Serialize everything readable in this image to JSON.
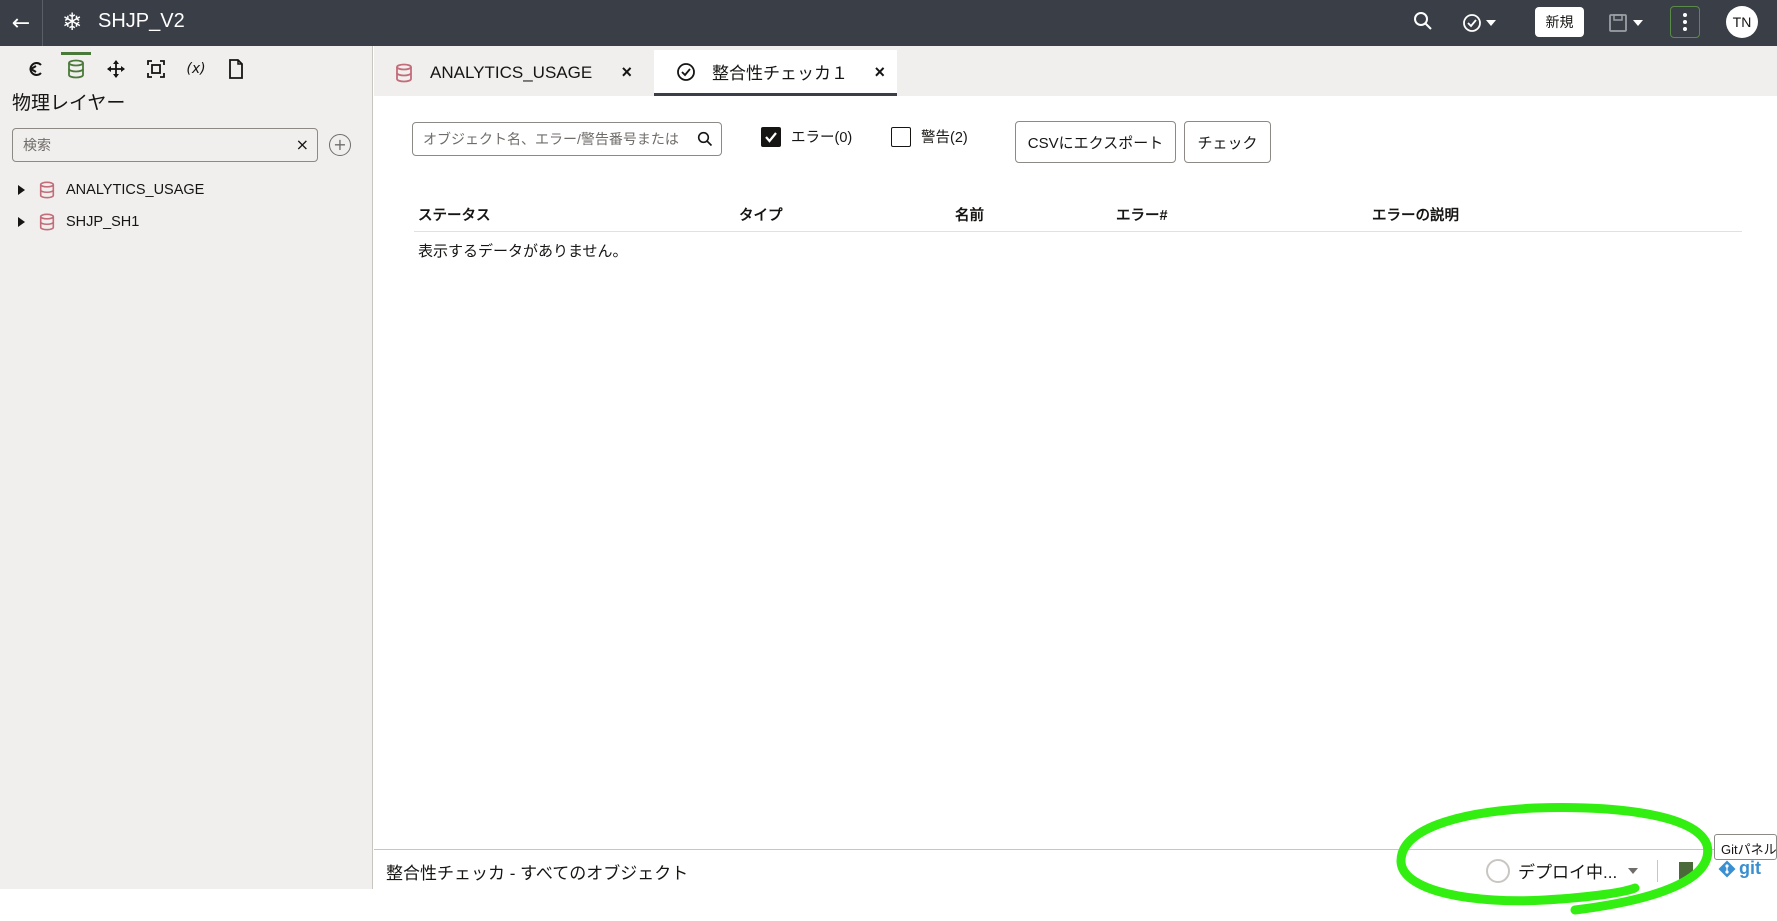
{
  "header": {
    "back_label": "←",
    "app_title": "SHJP_V2",
    "new_button": "新規",
    "avatar_initials": "TN"
  },
  "left_panel": {
    "title": "物理レイヤー",
    "search_placeholder": "検索",
    "search_clear": "×",
    "add_label": "+",
    "tools": [
      "refresh-icon",
      "database-icon",
      "move-icon",
      "frame-icon",
      "variable-icon",
      "document-icon"
    ],
    "tools_variable_label": "(x)",
    "tree": [
      {
        "label": "ANALYTICS_USAGE"
      },
      {
        "label": "SHJP_SH1"
      }
    ]
  },
  "tabs": [
    {
      "label": "ANALYTICS_USAGE",
      "icon": "database-icon",
      "close": "×",
      "active": false
    },
    {
      "label": "整合性チェッカ１",
      "icon": "check-circle-icon",
      "close": "×",
      "active": true
    }
  ],
  "main": {
    "filter_placeholder": "オブジェクト名、エラー/警告番号または",
    "errors_checkbox": {
      "label": "エラー(0)",
      "checked": true
    },
    "warnings_checkbox": {
      "label": "警告(2)",
      "checked": false
    },
    "export_button": "CSVにエクスポート",
    "check_button": "チェック",
    "table": {
      "columns": [
        "ステータス",
        "タイプ",
        "名前",
        "エラー#",
        "エラーの説明"
      ],
      "empty_message": "表示するデータがありません。"
    }
  },
  "status_bar": {
    "label": "整合性チェッカ -   すべてのオブジェクト",
    "deploy_label": "デプロイ中...",
    "git_label": "git",
    "git_tooltip": "Gitパネル"
  },
  "colors": {
    "header_bg": "#3a3f47",
    "panel_bg": "#f1efed",
    "db_icon": "#c26d7a",
    "annotation_green": "#33ee11",
    "git_blue": "#3a8fd0"
  }
}
